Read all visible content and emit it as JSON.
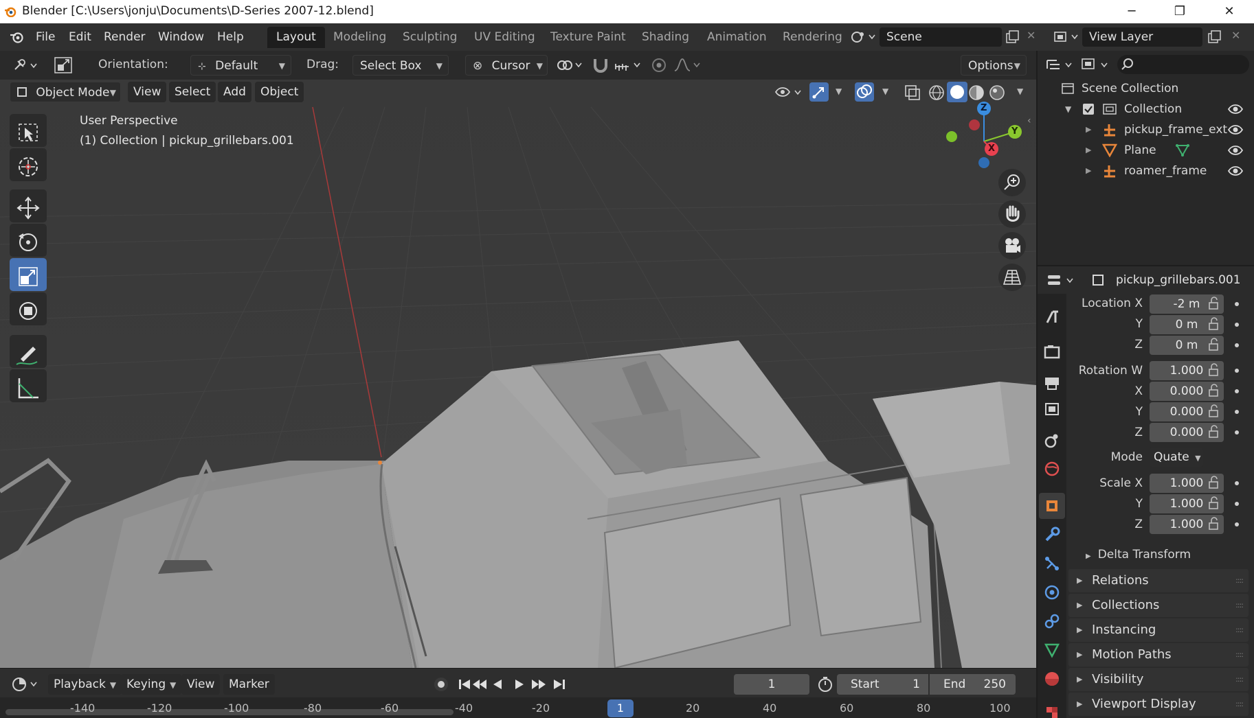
{
  "window": {
    "title": "Blender [C:\\Users\\jonju\\Documents\\D-Series 2007-12.blend]",
    "minimize": "─",
    "restore": "❐",
    "close": "✕"
  },
  "menu": [
    "File",
    "Edit",
    "Render",
    "Window",
    "Help"
  ],
  "workspaces": [
    "Layout",
    "Modeling",
    "Sculpting",
    "UV Editing",
    "Texture Paint",
    "Shading",
    "Animation",
    "Rendering"
  ],
  "active_workspace": "Layout",
  "scene": {
    "name": "Scene",
    "view_layer": "View Layer"
  },
  "toolheader": {
    "orientation_label": "Orientation:",
    "orientation_value": "Default",
    "drag_label": "Drag:",
    "drag_value": "Select Box",
    "pivot_value": "Cursor",
    "options_label": "Options"
  },
  "modeheader": {
    "mode": "Object Mode",
    "items": [
      "View",
      "Select",
      "Add",
      "Object"
    ]
  },
  "viewport": {
    "line1": "User Perspective",
    "line2": "(1) Collection | pickup_grillebars.001",
    "gizmo": {
      "x": "X",
      "y": "Y",
      "z": "Z"
    }
  },
  "outliner": {
    "root": "Scene Collection",
    "collection": "Collection",
    "items": [
      "pickup_frame_ext",
      "Plane",
      "roamer_frame"
    ]
  },
  "properties": {
    "object_name": "pickup_grillebars.001",
    "location_label": "Location X",
    "location": [
      "-2 m",
      "0 m",
      "0 m"
    ],
    "rotation_label": "Rotation W",
    "rotation": [
      "1.000",
      "0.000",
      "0.000",
      "0.000"
    ],
    "mode_label": "Mode",
    "mode_value": "Quate",
    "scale_label": "Scale X",
    "scale": [
      "1.000",
      "1.000",
      "1.000"
    ],
    "axis_y": "Y",
    "axis_z": "Z",
    "axis_x": "X",
    "delta": "Delta Transform",
    "panels": [
      "Relations",
      "Collections",
      "Instancing",
      "Motion Paths",
      "Visibility",
      "Viewport Display"
    ]
  },
  "timeline": {
    "menus": [
      "Playback",
      "Keying",
      "View",
      "Marker"
    ],
    "current_frame": "1",
    "start_label": "Start",
    "start": "1",
    "end_label": "End",
    "end": "250",
    "ticks": [
      "-140",
      "-120",
      "-100",
      "-80",
      "-60",
      "-40",
      "-20",
      "1",
      "20",
      "40",
      "60",
      "80",
      "100"
    ]
  },
  "colors": {
    "accent": "#4772b3",
    "x_axis": "#e8414f",
    "y_axis": "#8ac82e",
    "z_axis": "#3a8de0",
    "object_orange": "#e9863a"
  }
}
